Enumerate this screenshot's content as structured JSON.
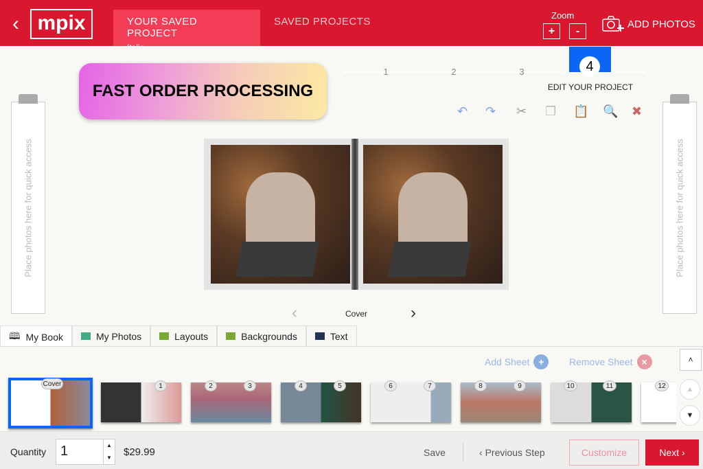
{
  "header": {
    "logo": "mpix",
    "active_tab": "YOUR SAVED PROJECT",
    "active_sub": "Italia",
    "tab2": "SAVED PROJECTS",
    "zoom_label": "Zoom",
    "zoom_in": "+",
    "zoom_out": "-",
    "add_photos": "ADD PHOTOS"
  },
  "banner": "FAST ORDER PROCESSING",
  "steps": {
    "s1": "1",
    "s2": "2",
    "s3": "3",
    "s4": "4",
    "current_label": "EDIT YOUR PROJECT"
  },
  "side_hint": "Place photos here for quick access",
  "page_nav": {
    "label": "Cover"
  },
  "tabs": [
    "My Book",
    "My Photos",
    "Layouts",
    "Backgrounds",
    "Text"
  ],
  "sheet": {
    "add": "Add Sheet",
    "remove": "Remove Sheet"
  },
  "thumbs": [
    {
      "n": "Cover"
    },
    {
      "n": "1"
    },
    {
      "n": "2",
      "m": "3"
    },
    {
      "n": "4",
      "m": "5"
    },
    {
      "n": "6",
      "m": "7"
    },
    {
      "n": "8",
      "m": "9"
    },
    {
      "n": "10",
      "m": "11"
    },
    {
      "n": "12"
    }
  ],
  "footer": {
    "quantity_label": "Quantity",
    "quantity": "1",
    "price": "$29.99",
    "save": "Save",
    "prev": "Previous Step",
    "customize": "Customize",
    "next": "Next"
  },
  "colors": {
    "brand": "#d9172f",
    "step_active": "#0a66f5"
  }
}
